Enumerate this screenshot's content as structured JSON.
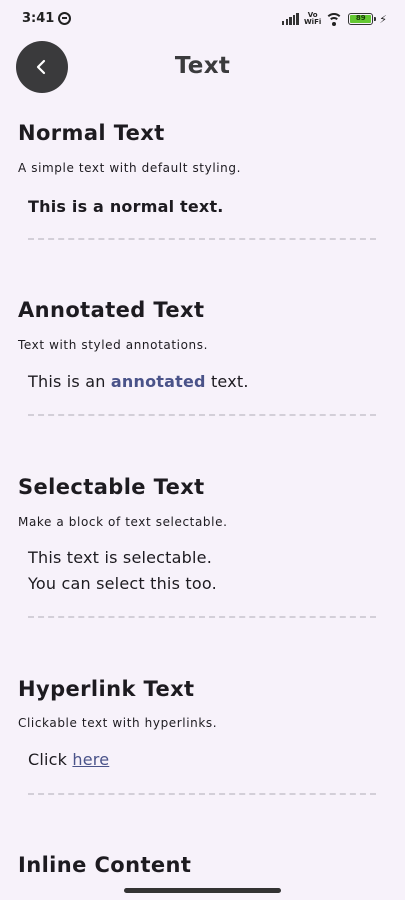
{
  "status_bar": {
    "time": "3:41",
    "volte_top": "Vo",
    "volte_bottom": "WiFi",
    "battery": "89"
  },
  "header": {
    "title": "Text"
  },
  "sections": [
    {
      "title": "Normal Text",
      "description": "A simple text with default styling.",
      "sample": "This is a normal text."
    },
    {
      "title": "Annotated Text",
      "description": "Text with styled annotations.",
      "sample_prefix": "This is an ",
      "sample_emphasis": "annotated",
      "sample_suffix": " text."
    },
    {
      "title": "Selectable Text",
      "description": "Make a block of text selectable.",
      "sample_line1": "This text is selectable.",
      "sample_line2": "You can select this too."
    },
    {
      "title": "Hyperlink Text",
      "description": "Clickable text with hyperlinks.",
      "sample_prefix": "Click ",
      "link_label": "here"
    },
    {
      "title": "Inline Content"
    }
  ],
  "colors": {
    "background": "#f7f2fa",
    "back_button": "#3a3a3c",
    "accent": "#4a5389"
  }
}
